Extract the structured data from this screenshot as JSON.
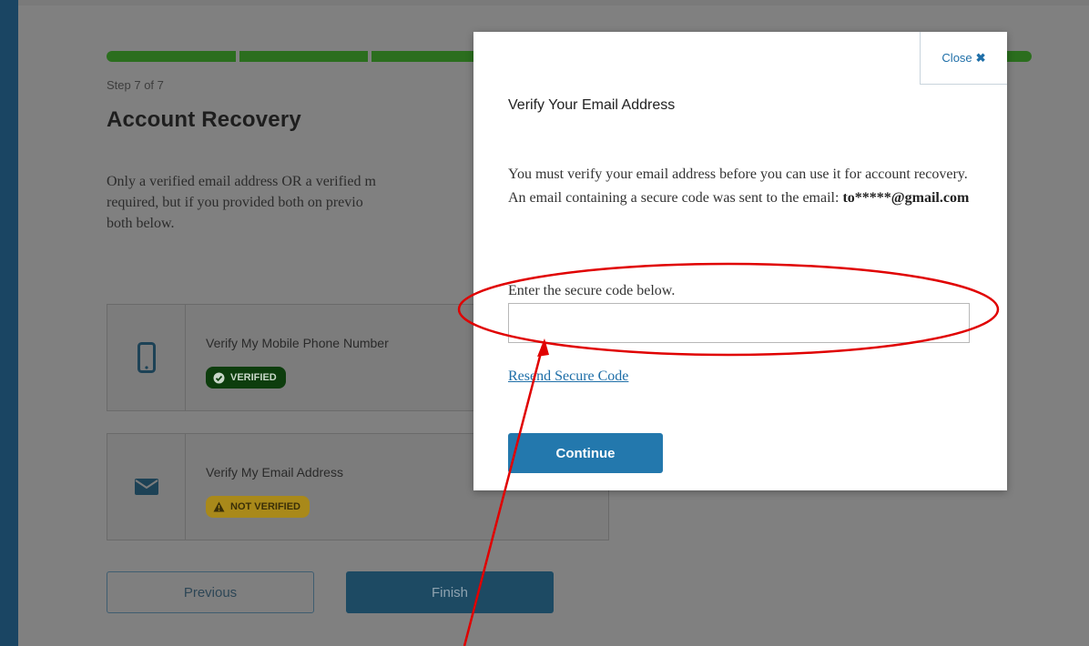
{
  "progress": {
    "segments": 7,
    "completed": 7,
    "color": "#2b6e1e"
  },
  "step_label": "Step 7 of 7",
  "page_title": "Account Recovery",
  "description": "Only a verified email address OR a verified m... required, but if you provided both on previo... both below.",
  "description_lines": [
    "Only a verified email address OR a verified m",
    "required, but if you provided both on previo",
    "both below."
  ],
  "cards": [
    {
      "label": "Verify My Mobile Phone Number",
      "badge": "VERIFIED",
      "icon": "mobile-phone-icon"
    },
    {
      "label": "Verify My Email Address",
      "badge": "NOT VERIFIED",
      "icon": "envelope-icon"
    }
  ],
  "buttons": {
    "previous": "Previous",
    "finish": "Finish"
  },
  "modal": {
    "close_label": "Close",
    "title": "Verify Your Email Address",
    "text_before": "You must verify your email address before you can use it for account recovery. An email containing a secure code was sent to the email: ",
    "email": "to*****@gmail.com",
    "code_label": "Enter the secure code below.",
    "code_value": "",
    "resend_label": "Resend Secure Code",
    "continue_label": "Continue"
  },
  "annotation": {
    "color": "#e00000"
  }
}
